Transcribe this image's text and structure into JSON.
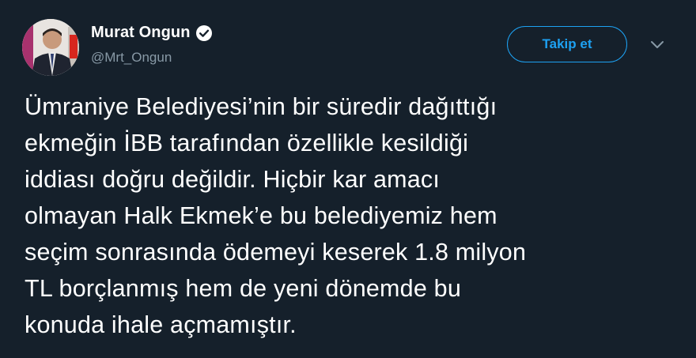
{
  "author": {
    "display_name": "Murat Ongun",
    "handle": "@Mrt_Ongun",
    "verified": true
  },
  "actions": {
    "follow_label": "Takip et",
    "menu_icon": "chevron-down-icon"
  },
  "tweet": {
    "text": "Ümraniye Belediyesi’nin bir süredir dağıttığı\nekmeğin İBB tarafından özellikle kesildiği\niddiası doğru değildir. Hiçbir kar amacı\nolmayan Halk Ekmek’e bu belediyemiz hem\nseçim sonrasında ödemeyi keserek 1.8 milyon\nTL borçlanmış hem de yeni dönemde bu\nkonuda ihale açmamıştır."
  },
  "colors": {
    "background": "#15202b",
    "accent": "#1da1f2",
    "secondary_text": "#8899a6"
  }
}
